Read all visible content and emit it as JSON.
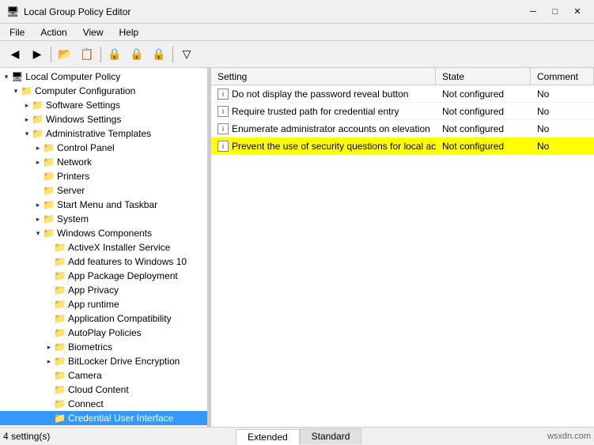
{
  "titleBar": {
    "title": "Local Group Policy Editor",
    "icon": "🖥",
    "controls": {
      "minimize": "─",
      "maximize": "□",
      "close": "✕"
    }
  },
  "menuBar": {
    "items": [
      "File",
      "Action",
      "View",
      "Help"
    ]
  },
  "toolbar": {
    "buttons": [
      "◀",
      "▶",
      "↑",
      "📋",
      "📋",
      "🔒",
      "🔒",
      "🔒",
      "▽"
    ]
  },
  "tree": {
    "items": [
      {
        "id": "local-computer-policy",
        "label": "Local Computer Policy",
        "level": 0,
        "expanded": true,
        "hasChildren": true
      },
      {
        "id": "computer-configuration",
        "label": "Computer Configuration",
        "level": 1,
        "expanded": true,
        "hasChildren": true
      },
      {
        "id": "software-settings",
        "label": "Software Settings",
        "level": 2,
        "expanded": false,
        "hasChildren": true
      },
      {
        "id": "windows-settings",
        "label": "Windows Settings",
        "level": 2,
        "expanded": false,
        "hasChildren": true
      },
      {
        "id": "administrative-templates",
        "label": "Administrative Templates",
        "level": 2,
        "expanded": true,
        "hasChildren": true
      },
      {
        "id": "control-panel",
        "label": "Control Panel",
        "level": 3,
        "expanded": false,
        "hasChildren": true
      },
      {
        "id": "network",
        "label": "Network",
        "level": 3,
        "expanded": false,
        "hasChildren": true
      },
      {
        "id": "printers",
        "label": "Printers",
        "level": 3,
        "expanded": false,
        "hasChildren": true
      },
      {
        "id": "server",
        "label": "Server",
        "level": 3,
        "expanded": false,
        "hasChildren": true
      },
      {
        "id": "start-menu-taskbar",
        "label": "Start Menu and Taskbar",
        "level": 3,
        "expanded": false,
        "hasChildren": true
      },
      {
        "id": "system",
        "label": "System",
        "level": 3,
        "expanded": false,
        "hasChildren": true
      },
      {
        "id": "windows-components",
        "label": "Windows Components",
        "level": 3,
        "expanded": true,
        "hasChildren": true
      },
      {
        "id": "activex",
        "label": "ActiveX Installer Service",
        "level": 4,
        "expanded": false,
        "hasChildren": false
      },
      {
        "id": "add-features",
        "label": "Add features to Windows 10",
        "level": 4,
        "expanded": false,
        "hasChildren": false
      },
      {
        "id": "app-package",
        "label": "App Package Deployment",
        "level": 4,
        "expanded": false,
        "hasChildren": false
      },
      {
        "id": "app-privacy",
        "label": "App Privacy",
        "level": 4,
        "expanded": false,
        "hasChildren": false
      },
      {
        "id": "app-runtime",
        "label": "App runtime",
        "level": 4,
        "expanded": false,
        "hasChildren": false
      },
      {
        "id": "app-compat",
        "label": "Application Compatibility",
        "level": 4,
        "expanded": false,
        "hasChildren": false
      },
      {
        "id": "autoplay",
        "label": "AutoPlay Policies",
        "level": 4,
        "expanded": false,
        "hasChildren": false
      },
      {
        "id": "biometrics",
        "label": "Biometrics",
        "level": 4,
        "expanded": false,
        "hasChildren": true
      },
      {
        "id": "bitlocker",
        "label": "BitLocker Drive Encryption",
        "level": 4,
        "expanded": false,
        "hasChildren": true
      },
      {
        "id": "camera",
        "label": "Camera",
        "level": 4,
        "expanded": false,
        "hasChildren": false
      },
      {
        "id": "cloud-content",
        "label": "Cloud Content",
        "level": 4,
        "expanded": false,
        "hasChildren": false
      },
      {
        "id": "connect",
        "label": "Connect",
        "level": 4,
        "expanded": false,
        "hasChildren": false
      },
      {
        "id": "credential-ui",
        "label": "Credential User Interface",
        "level": 4,
        "expanded": false,
        "hasChildren": false,
        "selected": true
      }
    ]
  },
  "listView": {
    "columns": [
      {
        "id": "setting",
        "label": "Setting"
      },
      {
        "id": "state",
        "label": "State"
      },
      {
        "id": "comment",
        "label": "Comment"
      }
    ],
    "rows": [
      {
        "id": "row1",
        "setting": "Do not display the password reveal button",
        "state": "Not configured",
        "comment": "No",
        "highlighted": false
      },
      {
        "id": "row2",
        "setting": "Require trusted path for credential entry",
        "state": "Not configured",
        "comment": "No",
        "highlighted": false
      },
      {
        "id": "row3",
        "setting": "Enumerate administrator accounts on elevation",
        "state": "Not configured",
        "comment": "No",
        "highlighted": false
      },
      {
        "id": "row4",
        "setting": "Prevent the use of security questions for local accounts",
        "state": "Not configured",
        "comment": "No",
        "highlighted": true
      }
    ]
  },
  "tabs": [
    {
      "id": "extended",
      "label": "Extended",
      "active": true
    },
    {
      "id": "standard",
      "label": "Standard",
      "active": false
    }
  ],
  "statusBar": {
    "left": "4 setting(s)",
    "right": "wsxdn.com"
  }
}
